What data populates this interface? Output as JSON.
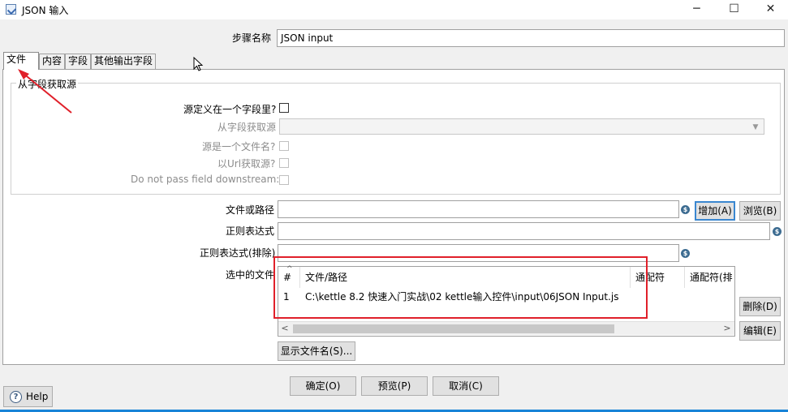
{
  "window": {
    "title": "JSON 输入",
    "minimize": "─",
    "maximize": "☐",
    "close": "✕"
  },
  "step_name": {
    "label": "步骤名称",
    "value": "JSON input"
  },
  "tabs": [
    {
      "label": "文件"
    },
    {
      "label": "内容"
    },
    {
      "label": "字段"
    },
    {
      "label": "其他输出字段"
    }
  ],
  "source_group": {
    "title": "从字段获取源",
    "source_in_field_label": "源定义在一个字段里?",
    "get_from_field_label": "从字段获取源",
    "source_is_filename_label": "源是一个文件名?",
    "read_source_as_url_label": "以Url获取源?",
    "do_not_pass_label": "Do not pass field downstream:"
  },
  "file": {
    "file_or_dir_label": "文件或路径",
    "regex_label": "正则表达式",
    "exclude_regex_label": "正则表达式(排除)",
    "selected_files_label": "选中的文件",
    "add_button": "增加(A)",
    "browse_button": "浏览(B)",
    "delete_button": "删除(D)",
    "edit_button": "编辑(E)",
    "show_filenames_button": "显示文件名(S)...",
    "var_icon": "$"
  },
  "table": {
    "columns": [
      "#",
      "文件/路径",
      "通配符",
      "通配符(排"
    ],
    "rows": [
      {
        "num": "1",
        "path": "C:\\kettle 8.2 快速入门实战\\02 kettle输入控件\\input\\06JSON Input.js",
        "wildcard": "",
        "wildcard_exclude": ""
      }
    ],
    "sort_indicator": "^",
    "scroll_left": "<",
    "scroll_right": ">"
  },
  "footer": {
    "ok_button": "确定(O)",
    "preview_button": "预览(P)",
    "cancel_button": "取消(C)",
    "help_button": "Help",
    "help_icon": "?"
  },
  "accent_colors": {
    "annotation_red": "#e0202a",
    "focus_blue": "#3a87d0"
  }
}
